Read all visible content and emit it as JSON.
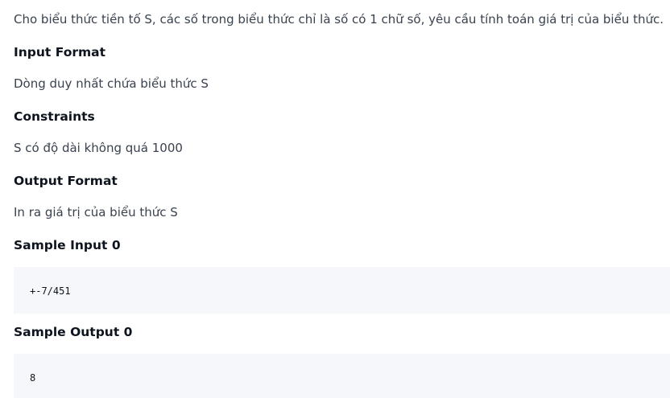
{
  "problem": {
    "description": "Cho biểu thức tiền tố S, các số trong biểu thức chỉ là số có 1 chữ số, yêu cầu tính toán giá trị của biểu thức.",
    "input_format": {
      "heading": "Input Format",
      "text": "Dòng duy nhất chứa biểu thức S"
    },
    "constraints": {
      "heading": "Constraints",
      "text": "S có độ dài không quá 1000"
    },
    "output_format": {
      "heading": "Output Format",
      "text": "In ra giá trị của biểu thức S"
    },
    "sample_input": {
      "heading": "Sample Input 0",
      "code": "+-7/451"
    },
    "sample_output": {
      "heading": "Sample Output 0",
      "code": "8"
    }
  }
}
